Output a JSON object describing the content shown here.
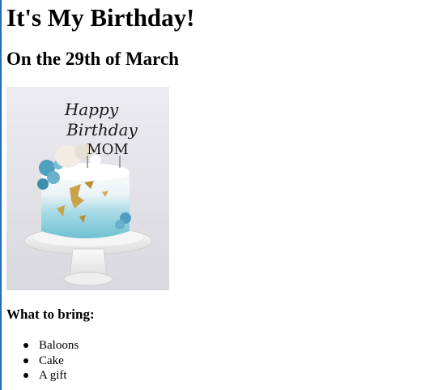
{
  "page": {
    "title": "It's My Birthday!",
    "subtitle": "On the 29th of March",
    "image_alt": "Happy Birthday Mom cake",
    "bring_heading": "What to bring:",
    "bring_items": [
      "Baloons",
      "Cake",
      "A gift"
    ]
  },
  "colors": {
    "text": "#000000",
    "background": "#ffffff",
    "left_border": "#2b6cb0"
  }
}
